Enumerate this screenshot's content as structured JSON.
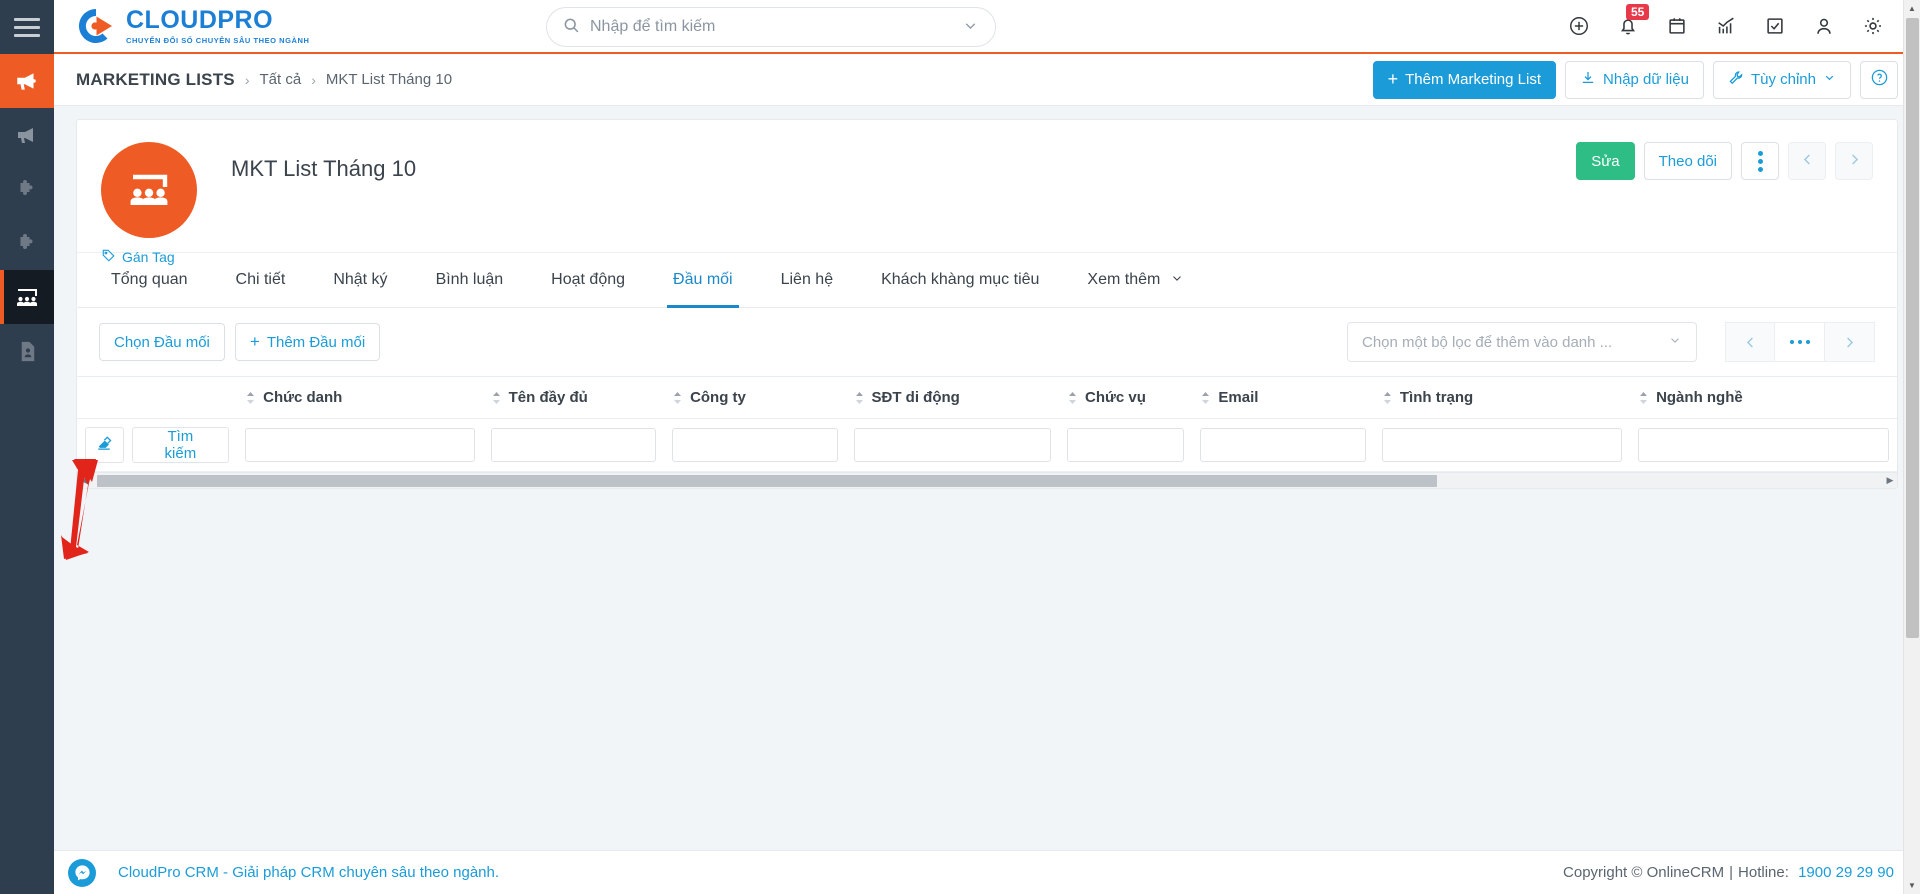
{
  "rail": {
    "menu_icon": "hamburger-menu-icon",
    "items": [
      {
        "name": "campaign-active",
        "icon": "megaphone-icon",
        "state": "orange"
      },
      {
        "name": "campaign",
        "icon": "megaphone-icon",
        "state": "normal"
      },
      {
        "name": "module-one",
        "icon": "puzzle-icon",
        "state": "normal"
      },
      {
        "name": "module-two",
        "icon": "puzzle-icon",
        "state": "normal"
      },
      {
        "name": "marketing-lists",
        "icon": "group-people-icon",
        "state": "active"
      },
      {
        "name": "documents",
        "icon": "contact-card-icon",
        "state": "normal"
      }
    ]
  },
  "brand": {
    "name": "CLOUDPRO",
    "tagline": "CHUYỂN ĐỔI SỐ CHUYÊN SÂU THEO NGÀNH",
    "color": "#1c7fd6",
    "accent": "#ef5b25"
  },
  "search": {
    "placeholder": "Nhập để tìm kiếm",
    "value": "",
    "icon": "search-icon",
    "chevron": "chevron-down-icon"
  },
  "topbar_icons": [
    {
      "name": "add-icon",
      "label": "plus-circle-icon"
    },
    {
      "name": "notifications-icon",
      "label": "bell-icon",
      "badge": "55"
    },
    {
      "name": "calendar-icon",
      "label": "calendar-icon"
    },
    {
      "name": "reports-icon",
      "label": "chart-icon"
    },
    {
      "name": "tasks-icon",
      "label": "checkbox-icon"
    },
    {
      "name": "profile-icon",
      "label": "user-icon"
    },
    {
      "name": "settings-icon",
      "label": "gear-icon"
    }
  ],
  "breadcrumb": {
    "module": "MARKETING LISTS",
    "separator": "›",
    "parent": "Tất cả",
    "current": "MKT List Tháng 10"
  },
  "page_actions": {
    "add_label": "Thêm Marketing List",
    "add_plus": "+",
    "import_label": "Nhập dữ liệu",
    "import_icon": "import-download-icon",
    "customize_label": "Tùy chỉnh",
    "customize_icon": "wrench-icon",
    "customize_chevron": "chevron-down-icon",
    "help_label": "?",
    "help_icon": "question-circle-icon"
  },
  "record": {
    "avatar_icon": "group-people-icon",
    "avatar_color": "#ef5b25",
    "title": "MKT List Tháng 10",
    "tag_link": "Gán Tag",
    "tag_icon": "tag-icon",
    "edit_label": "Sửa",
    "follow_label": "Theo dõi",
    "more_icon": "vertical-dots-icon",
    "prev_icon": "chevron-left-icon",
    "next_icon": "chevron-right-icon"
  },
  "tabs": [
    {
      "label": "Tổng quan",
      "active": false
    },
    {
      "label": "Chi tiết",
      "active": false
    },
    {
      "label": "Nhật ký",
      "active": false
    },
    {
      "label": "Bình luận",
      "active": false
    },
    {
      "label": "Hoạt động",
      "active": false
    },
    {
      "label": "Đầu mối",
      "active": true
    },
    {
      "label": "Liên hệ",
      "active": false
    },
    {
      "label": "Khách khàng mục tiêu",
      "active": false
    },
    {
      "label": "Xem thêm",
      "active": false,
      "chevron": "chevron-down-icon"
    }
  ],
  "toolbar": {
    "select_label": "Chọn Đầu mối",
    "add_label": "Thêm Đầu mối",
    "add_plus": "+",
    "filter_placeholder": "Chọn một bộ lọc để thêm vào danh ...",
    "filter_chevron": "chevron-down-icon",
    "pager_prev": "chevron-left-icon",
    "pager_more": "horizontal-dots-icon",
    "pager_next": "chevron-right-icon"
  },
  "table": {
    "columns": [
      "Chức danh",
      "Tên đầy đủ",
      "Công ty",
      "SĐT di động",
      "Chức vụ",
      "Email",
      "Tình trạng",
      "Ngành nghề"
    ],
    "search_row": {
      "clear_icon": "eraser-icon",
      "search_label": "Tìm kiếm",
      "inputs": [
        "",
        "",
        "",
        "",
        "",
        "",
        "",
        ""
      ]
    },
    "rows": []
  },
  "footer": {
    "chat_icon": "messenger-icon",
    "left_text": "CloudPro CRM - Giải pháp CRM chuyên sâu theo ngành.",
    "copyright": "Copyright © OnlineCRM",
    "divider": "|",
    "hotline_label": "Hotline:",
    "hotline": "1900 29 29 90"
  },
  "annotation": {
    "type": "red-arrow",
    "points_to": "Chọn Đầu mối",
    "color": "#e1251b"
  }
}
